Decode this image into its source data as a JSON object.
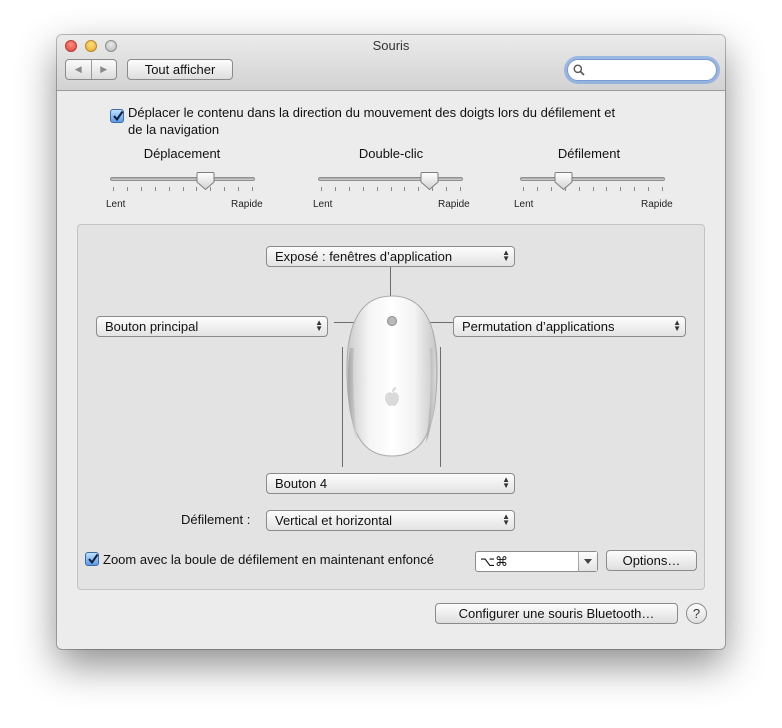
{
  "window": {
    "title": "Souris"
  },
  "toolbar": {
    "back_icon": "◀",
    "forward_icon": "▶",
    "show_all_label": "Tout afficher",
    "search_value": ""
  },
  "scroll_direction": {
    "checked": true,
    "label_line1": "Déplacer le contenu dans la direction du mouvement des doigts lors du défilement et",
    "label_line2": "de la navigation"
  },
  "sliders": [
    {
      "title": "Déplacement",
      "min_label": "Lent",
      "max_label": "Rapide",
      "value": 0.66
    },
    {
      "title": "Double-clic",
      "min_label": "Lent",
      "max_label": "Rapide",
      "value": 0.77
    },
    {
      "title": "Défilement",
      "min_label": "Lent",
      "max_label": "Rapide",
      "value": 0.3
    }
  ],
  "mouse_panel": {
    "top_button": "Exposé : fenêtres d’application",
    "left_button": "Bouton principal",
    "right_button": "Permutation d’applications",
    "side_button": "Bouton 4",
    "scrolling_label": "Défilement :",
    "scrolling_value": "Vertical et horizontal",
    "zoom_checked": true,
    "zoom_label": "Zoom avec la boule de défilement en maintenant enfoncé",
    "zoom_modifier": "⌥⌘",
    "options_label": "Options…"
  },
  "footer": {
    "bluetooth_label": "Configurer une souris Bluetooth…",
    "help_label": "?"
  },
  "colors": {
    "accent": "#5a9be6",
    "focus_ring": "#6296e6"
  }
}
